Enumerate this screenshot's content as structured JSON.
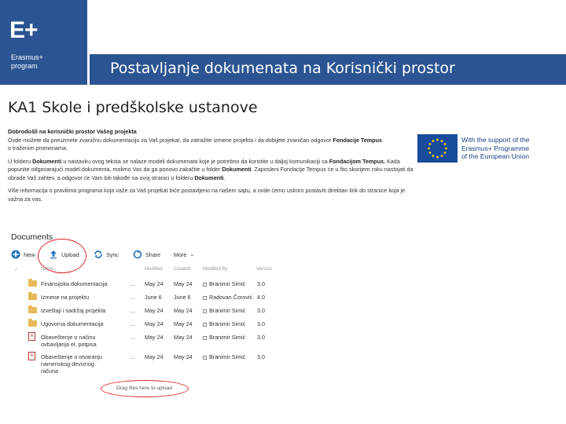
{
  "logo": {
    "mark": "E+",
    "line1": "Erasmus+",
    "line2": "program"
  },
  "title": "Postavljanje dokumenata na Korisnički prostor",
  "heading": "KA1 Skole i predškolske ustanove",
  "info": {
    "p1_a": "Dobrodošli na korisnički prostor Vašeg projekta",
    "p1_b": "Ovde možete da preuzmete zvaničnu dokumentaciju za Vaš projekat, da zatražite izmene projekta i da dobijete zvaničan odgovor",
    "p1_bold": "Fondacije Tempus",
    "p1_c": "o traženim promenama.",
    "p2_a": "U folderu",
    "p2_bold1": "Dokumenti",
    "p2_b": "u nastavku ovog teksta se nalaze modeli dokumenata koje je potrebno da koristite u daljoj komunikaciji sa",
    "p2_bold2": "Fondacijom Tempus.",
    "p2_c": "Kada popunite odgovarajući model dokumenta, molimo Vas da ga ponovo zakačite u folder",
    "p2_bold3": "Dokumenti",
    "p2_d": ". Zaposleni Fondacije Tempus će u što skorijem roku nastojati da obrade Vaš zahtev, a odgovor će Vam biti takođe na ovoj stranici u folderu",
    "p2_bold4": "Dokumenti",
    "p3": "Više informacija o pravilima programa koja važe za Vaš projekat biće postavljeno na našem sajtu, a ovde ćemo uskoro postaviti direktan link do stranice koja je važna za vas."
  },
  "eu_badge": {
    "line1": "With the support of the",
    "line2": "Erasmus+ Programme",
    "line3": "of the European Union"
  },
  "documents": {
    "title": "Documents",
    "toolbar": {
      "new": "New",
      "upload": "Upload",
      "sync": "Sync",
      "share": "Share",
      "more": "More"
    },
    "headers": {
      "name": "Name",
      "modified": "Modified",
      "created": "Created",
      "modified_by": "Modified By",
      "version": "Version"
    },
    "rows": [
      {
        "name": "Finansijska dokumentacija",
        "modified": "May 24",
        "created": "May 24",
        "modified_by": "Branimir Simić",
        "version": "3.0"
      },
      {
        "name": "Izmene na projektu",
        "modified": "June 6",
        "created": "June 6",
        "modified_by": "Radovan Čorović",
        "version": "4.0"
      },
      {
        "name": "Izveštaji i sadržaj projekta",
        "modified": "May 24",
        "created": "May 24",
        "modified_by": "Branimir Simić",
        "version": "3.0"
      },
      {
        "name": "Ugovorna dokumentacija",
        "modified": "May 24",
        "created": "May 24",
        "modified_by": "Branimir Simić",
        "version": "3.0"
      },
      {
        "name_l1": "Obaveštenje o načinu",
        "name_l2": "ovbavljanja el. potpisa",
        "modified": "May 24",
        "created": "May 24",
        "modified_by": "Branimir Simić",
        "version": "3.0"
      },
      {
        "name_l1": "Obaveštenje o otvaranju",
        "name_l2": "namenskog deviznog",
        "name_l3": "računa",
        "modified": "May 24",
        "created": "May 24",
        "modified_by": "Branimir Simić",
        "version": "3.0"
      }
    ],
    "ellipsis": "...",
    "drag_text": "Drag files here to upload"
  },
  "colors": {
    "brand": "#2b5592",
    "highlight": "#d9262b",
    "folder": "#e7b95a",
    "accent_icon": "#1e73be"
  }
}
